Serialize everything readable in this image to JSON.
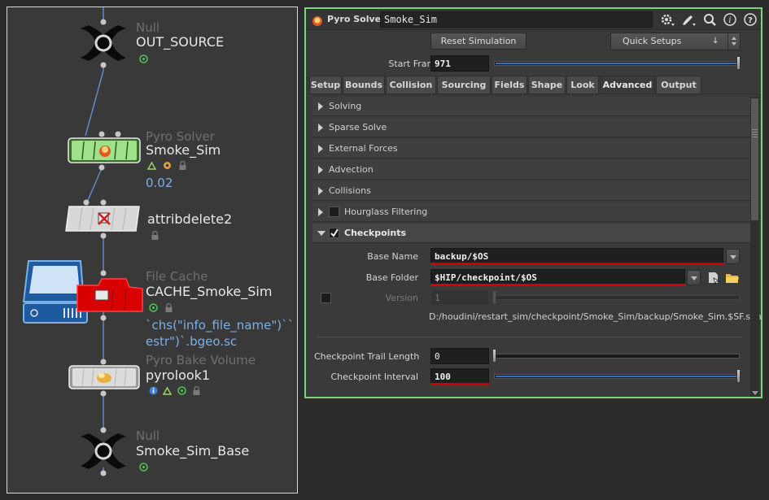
{
  "network": {
    "nodes": [
      {
        "type": "Null",
        "name": "OUT_SOURCE"
      },
      {
        "type": "Pyro Solver",
        "name": "Smoke_Sim",
        "value": "0.02"
      },
      {
        "type": "",
        "name": "attribdelete2"
      },
      {
        "type": "File Cache",
        "name": "CACHE_Smoke_Sim",
        "value_line1": "`chs(\"info_file_name\")``",
        "value_line2": "estr\")`.bgeo.sc"
      },
      {
        "type": "Pyro Bake Volume",
        "name": "pyrolook1"
      },
      {
        "type": "Null",
        "name": "Smoke_Sim_Base"
      }
    ]
  },
  "pane": {
    "node_type": "Pyro Solver",
    "node_name": "Smoke_Sim",
    "header_icons": [
      "gear-icon",
      "brush-icon",
      "magnifier-icon",
      "info-icon",
      "help-icon"
    ],
    "reset_button": "Reset Simulation",
    "quick_setups": "Quick Setups",
    "start_frame_label": "Start Frame",
    "start_frame_value": "971",
    "tabs": [
      "Setup",
      "Bounds",
      "Collision",
      "Sourcing",
      "Fields",
      "Shape",
      "Look",
      "Advanced",
      "Output"
    ],
    "active_tab": "Advanced",
    "folders": [
      "Solving",
      "Sparse Solve",
      "External Forces",
      "Advection",
      "Collisions",
      "Hourglass Filtering",
      "Checkpoints"
    ],
    "checkpoints": {
      "base_name_label": "Base Name",
      "base_name_value": "backup/$OS",
      "base_folder_label": "Base Folder",
      "base_folder_value": "$HIP/checkpoint/$OS",
      "version_label": "Version",
      "version_value": "1",
      "resolved_path": "D:/houdini/restart_sim/checkpoint/Smoke_Sim/backup/Smoke_Sim.$SF.sim",
      "trail_length_label": "Checkpoint Trail Length",
      "trail_length_value": "0",
      "interval_label": "Checkpoint Interval",
      "interval_value": "100"
    },
    "colors": {
      "accent_border": "#79d779",
      "highlight_red": "#d00000",
      "slider_blue": "#3b6fb8"
    }
  }
}
